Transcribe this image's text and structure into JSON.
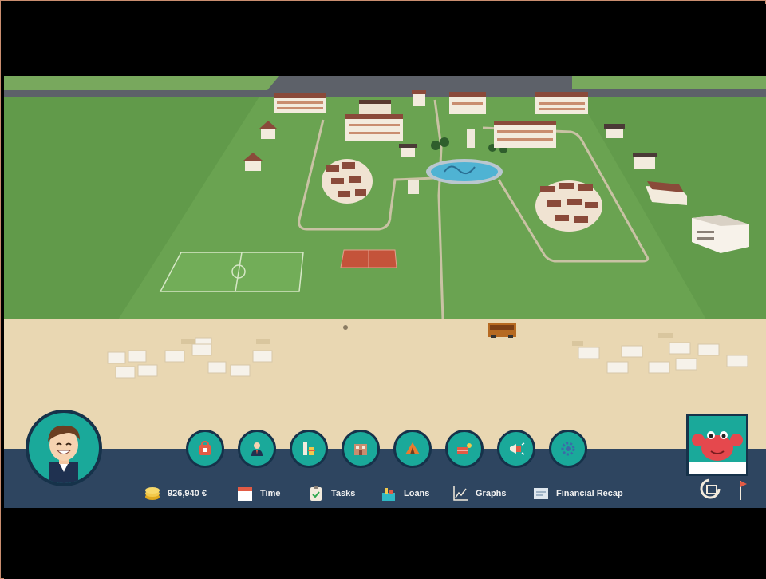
{
  "hud": {
    "money": {
      "value": "926,940 €",
      "icon": "coins-icon"
    },
    "time": {
      "label": "Time",
      "icon": "calendar-icon"
    },
    "tasks": {
      "label": "Tasks",
      "icon": "clipboard-icon"
    },
    "loans": {
      "label": "Loans",
      "icon": "bank-icon"
    },
    "graphs": {
      "label": "Graphs",
      "icon": "line-graph-icon"
    },
    "financial_recap": {
      "label": "Financial Recap",
      "icon": "report-icon"
    }
  },
  "action_buttons": [
    {
      "icon": "shop-icon"
    },
    {
      "icon": "staff-icon"
    },
    {
      "icon": "build-icon"
    },
    {
      "icon": "accommodation-icon"
    },
    {
      "icon": "camping-icon"
    },
    {
      "icon": "sports-icon"
    },
    {
      "icon": "marketing-icon"
    },
    {
      "icon": "settings-icon"
    }
  ],
  "player": {
    "avatar": "manager-avatar"
  },
  "rival": {
    "avatar": "crab-mascot"
  },
  "colors": {
    "grass": "#6aa351",
    "sand": "#e9d7b2",
    "road": "#5d6169",
    "hud_bar": "#2e4560",
    "button_teal": "#1aa99a"
  }
}
